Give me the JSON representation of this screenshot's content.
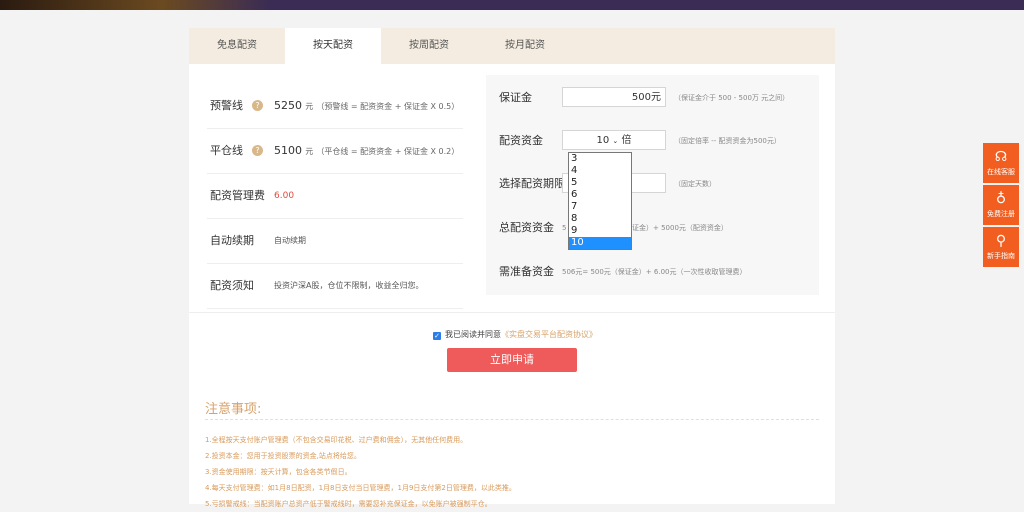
{
  "tabs": [
    {
      "label": "免息配资"
    },
    {
      "label": "按天配资"
    },
    {
      "label": "按周配资"
    },
    {
      "label": "按月配资"
    }
  ],
  "left": {
    "warn": {
      "label": "预警线",
      "value": "5250",
      "unit": "元",
      "formula": "（预警线 = 配资资金 + 保证金 X 0.5）"
    },
    "close": {
      "label": "平仓线",
      "value": "5100",
      "unit": "元",
      "formula": "（平仓线 = 配资资金 + 保证金 X 0.2）"
    },
    "fee": {
      "label": "配资管理费",
      "value": "6.00"
    },
    "renew": {
      "label": "自动续期",
      "value": "自动续期"
    },
    "notice": {
      "label": "配资须知",
      "value": "投资沪深A股，仓位不限制，收益全归您。"
    }
  },
  "right": {
    "deposit": {
      "label": "保证金",
      "value": "500元",
      "note": "（保证金介于 500 - 500万 元之间）"
    },
    "multiple": {
      "label": "配资资金",
      "value": "10",
      "suffix": "倍",
      "note": "（固定倍率 -- 配资资金为500元）"
    },
    "period": {
      "label": "选择配资期限",
      "note": "（固定天数）"
    },
    "total": {
      "label": "总配资资金",
      "prefix": "5",
      "note": "证金）+ 5000元（配资资金）"
    },
    "required": {
      "label": "需准备资金",
      "note": "506元= 500元（保证金）+ 6.00元（一次性收取管理费）"
    }
  },
  "dropdown": {
    "options": [
      "3",
      "4",
      "5",
      "6",
      "7",
      "8",
      "9",
      "10"
    ],
    "selected": "10"
  },
  "agree": {
    "text": "我已阅读并同意",
    "link": "《实盘交易平台配资协议》"
  },
  "apply_label": "立即申请",
  "notes": {
    "title": "注意事项:",
    "items": [
      "1.全程按天支付账户管理费（不包含交易印花税、过户费和佣金），无其他任何费用。",
      "2.投资本金：您用于投资股票的资金,站点将给您。",
      "3.资金使用期限：按天计算，包含各类节假日。",
      "4.每天支付管理费：如1月8日配资，1月8日支付当日管理费，1月9日支付第2日管理费，以此类推。",
      "5.亏损警戒线：当配资账户总资产低于警戒线时，需要您补充保证金，以免账户被强制平仓。"
    ]
  },
  "side_tools": [
    {
      "label": "在线客服",
      "icon": "headset-icon"
    },
    {
      "label": "免费注册",
      "icon": "bulb-icon"
    },
    {
      "label": "新手指南",
      "icon": "pin-icon"
    }
  ]
}
